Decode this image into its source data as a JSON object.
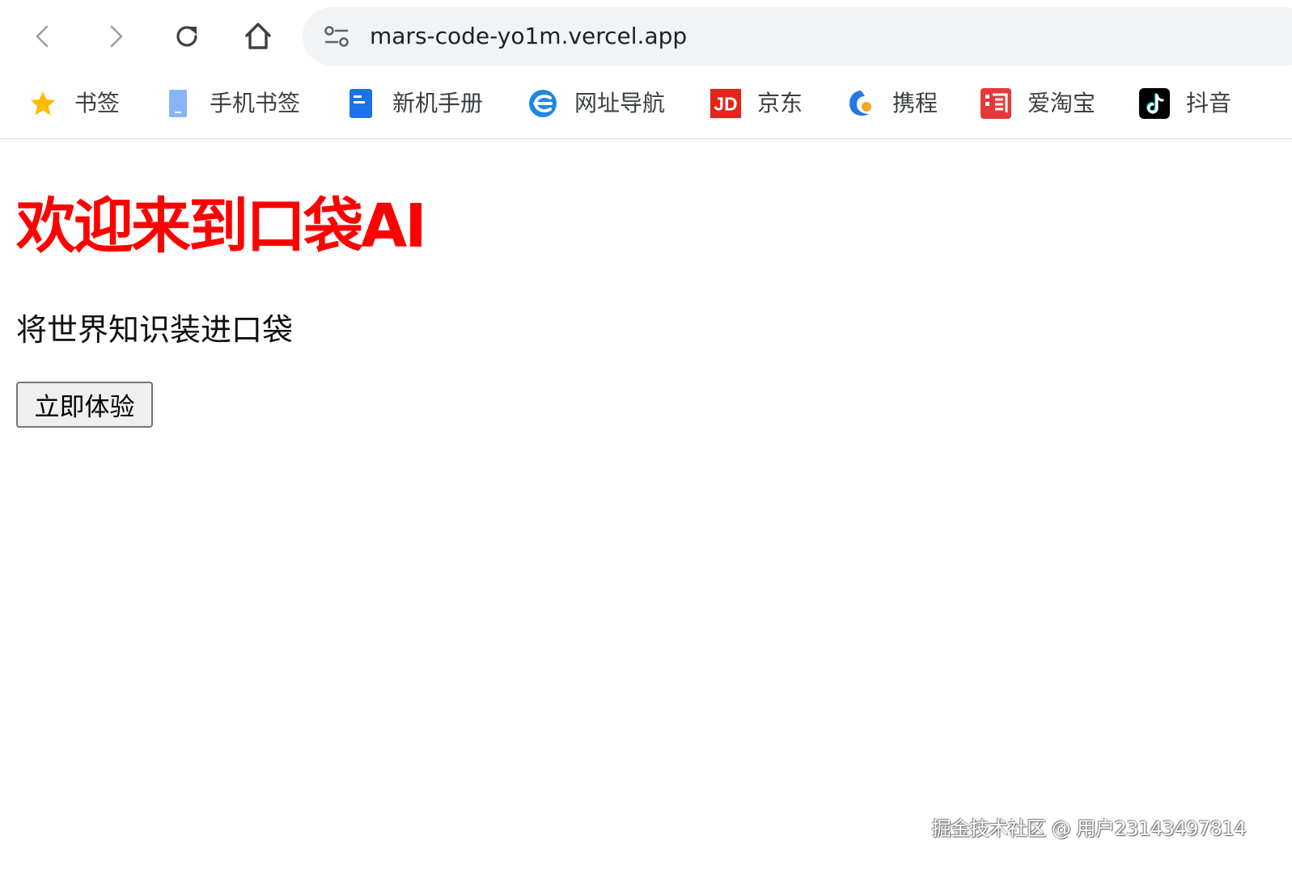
{
  "browser": {
    "url": "mars-code-yo1m.vercel.app",
    "nav_icons": [
      "back-arrow-icon",
      "forward-arrow-icon",
      "reload-icon",
      "home-icon"
    ],
    "site_info_icon": "tune-icon"
  },
  "bookmarks": [
    {
      "label": "书签",
      "icon": "star-icon",
      "color": "#fbbc04"
    },
    {
      "label": "手机书签",
      "icon": "mobile-icon",
      "color": "#8ab4f8"
    },
    {
      "label": "新机手册",
      "icon": "document-icon",
      "color": "#1a73e8"
    },
    {
      "label": "网址导航",
      "icon": "e-logo-icon",
      "color": "#1e88e5"
    },
    {
      "label": "京东",
      "icon": "jd-logo-icon",
      "color": "#e1251b"
    },
    {
      "label": "携程",
      "icon": "dolphin-logo-icon",
      "color": "#2577e3"
    },
    {
      "label": "爱淘宝",
      "icon": "taobao-logo-icon",
      "color": "#e4393c"
    },
    {
      "label": "抖音",
      "icon": "douyin-logo-icon",
      "color": "#000000"
    }
  ],
  "page": {
    "title": "欢迎来到口袋AI",
    "title_color": "#ff0000",
    "subtitle": "将世界知识装进口袋",
    "button_label": "立即体验"
  },
  "watermark": "掘金技术社区 @ 用户23143497814"
}
